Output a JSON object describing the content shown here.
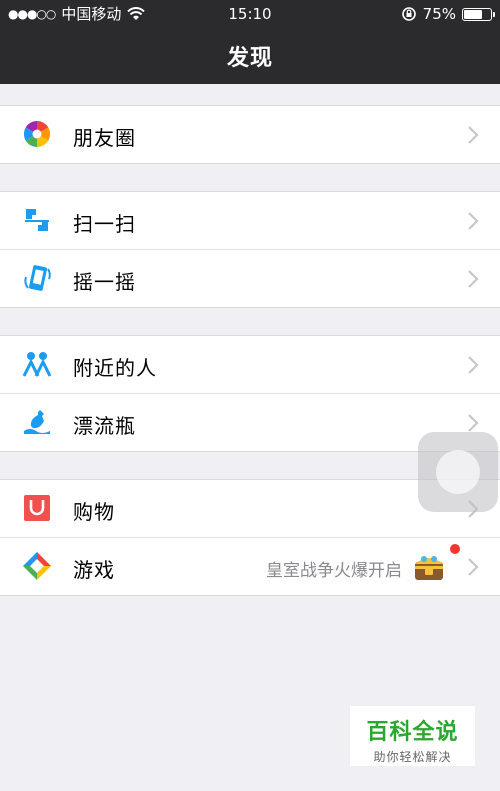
{
  "status_bar": {
    "signal_dots": "●●●○○",
    "carrier": "中国移动",
    "time": "15:10",
    "battery_percent_text": "75%",
    "battery_level": 0.75
  },
  "nav": {
    "title": "发现"
  },
  "groups": [
    {
      "items": [
        {
          "label": "朋友圈",
          "icon": "moments-icon"
        }
      ]
    },
    {
      "items": [
        {
          "label": "扫一扫",
          "icon": "scan-icon"
        },
        {
          "label": "摇一摇",
          "icon": "shake-icon"
        }
      ]
    },
    {
      "items": [
        {
          "label": "附近的人",
          "icon": "people-nearby-icon"
        },
        {
          "label": "漂流瓶",
          "icon": "drift-bottle-icon"
        }
      ]
    },
    {
      "items": [
        {
          "label": "购物",
          "icon": "shopping-icon"
        },
        {
          "label": "游戏",
          "icon": "games-icon",
          "extra": "皇室战争火爆开启"
        }
      ]
    }
  ],
  "watermark": {
    "title": "百科全说",
    "subtitle": "助你轻松解决"
  },
  "colors": {
    "nav_bg": "#2b2b2d",
    "page_bg": "#efeff4",
    "accent_blue": "#1a9cf0",
    "badge_red": "#f43530",
    "watermark_green": "#2aa82e"
  }
}
